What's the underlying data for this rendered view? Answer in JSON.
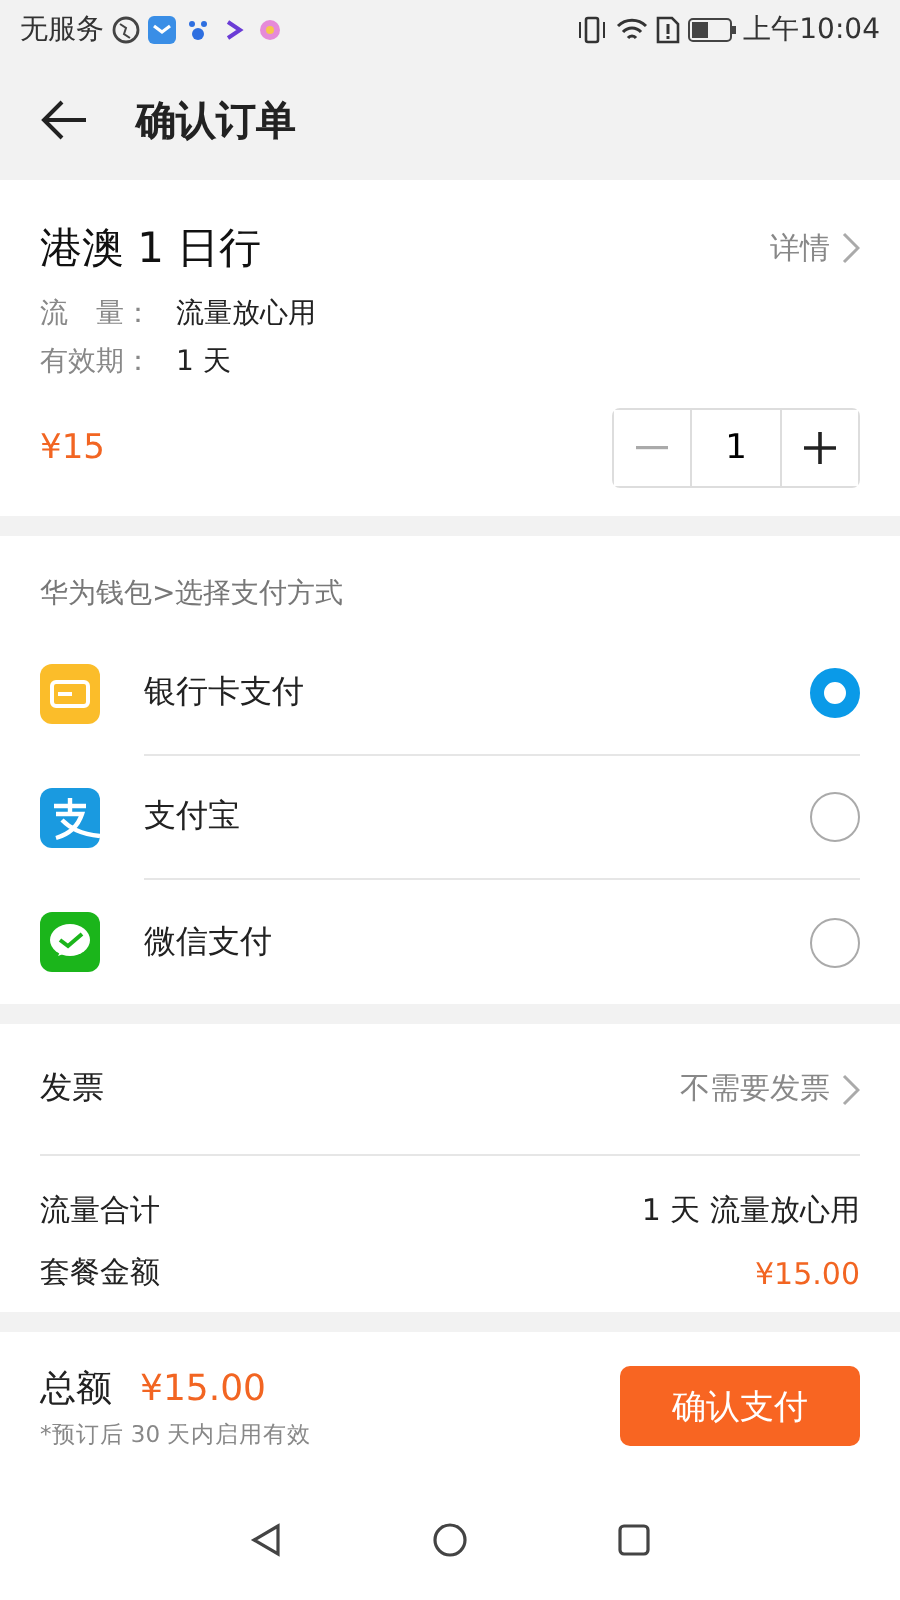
{
  "status_bar": {
    "carrier": "无服务",
    "time": "上午10:04"
  },
  "header": {
    "title": "确认订单"
  },
  "product": {
    "name": "港澳 1 日行",
    "details_link": "详情",
    "attributes": [
      {
        "label": "流　量：",
        "value": "流量放心用"
      },
      {
        "label": "有效期：",
        "value": "1 天"
      }
    ],
    "price": "¥15",
    "quantity": "1"
  },
  "payment": {
    "heading": "华为钱包>选择支付方式",
    "methods": [
      {
        "kind": "card",
        "label": "银行卡支付",
        "selected": true
      },
      {
        "kind": "alipay",
        "label": "支付宝",
        "selected": false
      },
      {
        "kind": "wechat",
        "label": "微信支付",
        "selected": false
      }
    ]
  },
  "invoice": {
    "label": "发票",
    "value": "不需要发票"
  },
  "summary": [
    {
      "label": "流量合计",
      "value": "1 天 流量放心用",
      "highlight": false
    },
    {
      "label": "套餐金额",
      "value": "¥15.00",
      "highlight": true
    }
  ],
  "footer": {
    "total_label": "总额",
    "total": "¥15.00",
    "note": "*预订后 30 天内启用有效",
    "button": "确认支付"
  }
}
